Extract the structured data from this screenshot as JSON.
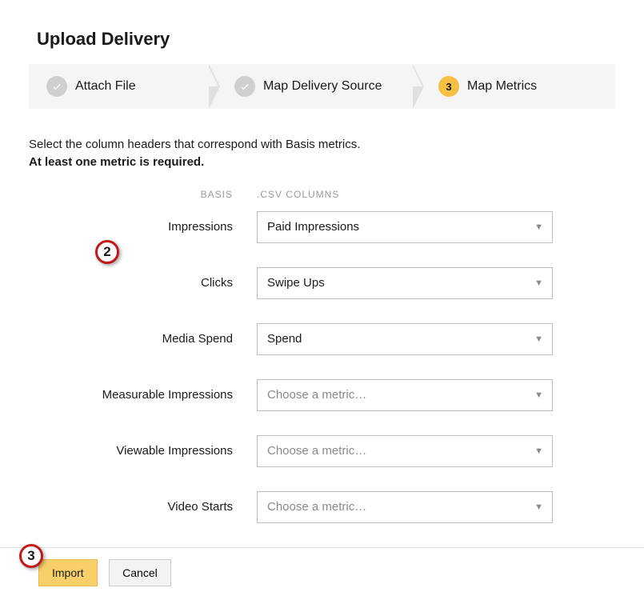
{
  "title": "Upload Delivery",
  "stepper": {
    "steps": [
      {
        "label": "Attach File",
        "state": "done"
      },
      {
        "label": "Map Delivery Source",
        "state": "done"
      },
      {
        "label": "Map Metrics",
        "state": "current",
        "number": "3"
      }
    ]
  },
  "intro": {
    "line1": "Select the column headers that correspond with Basis metrics.",
    "line2": "At least one metric is required."
  },
  "columns": {
    "basis": "BASIS",
    "csv": ".CSV COLUMNS"
  },
  "placeholder": "Choose a metric…",
  "rows": [
    {
      "label": "Impressions",
      "value": "Paid Impressions"
    },
    {
      "label": "Clicks",
      "value": "Swipe Ups"
    },
    {
      "label": "Media Spend",
      "value": "Spend"
    },
    {
      "label": "Measurable Impressions",
      "value": ""
    },
    {
      "label": "Viewable Impressions",
      "value": ""
    },
    {
      "label": "Video Starts",
      "value": ""
    }
  ],
  "buttons": {
    "import": "Import",
    "cancel": "Cancel"
  },
  "markers": {
    "m2": "2",
    "m3": "3"
  }
}
